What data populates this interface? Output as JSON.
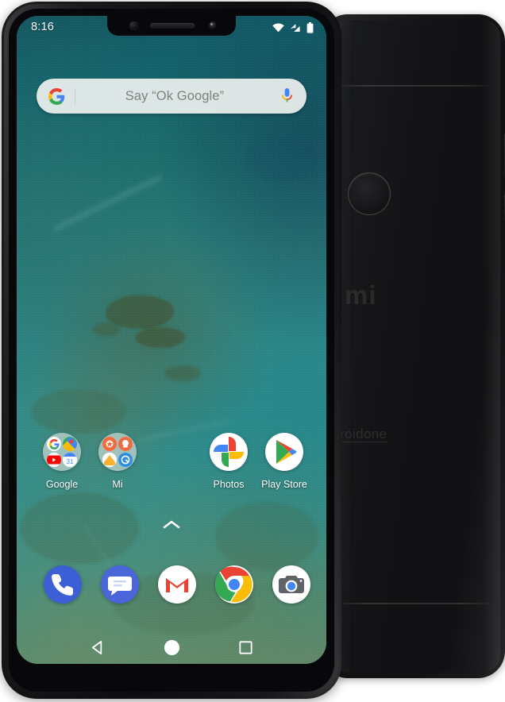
{
  "product": {
    "brand_logo": "mi",
    "program_text_visible": "roidone",
    "program_text_full": "androidone"
  },
  "front": {
    "statusbar": {
      "time": "8:16",
      "icons": [
        "wifi-icon",
        "signal-icon",
        "battery-icon"
      ]
    },
    "search": {
      "placeholder": "Say “Ok Google”",
      "left_icon": "google-g-icon",
      "right_icon": "microphone-icon"
    },
    "apps": [
      {
        "label": "Google",
        "icon": "google-folder-icon",
        "type": "folder"
      },
      {
        "label": "Mi",
        "icon": "mi-folder-icon",
        "type": "folder"
      },
      {
        "label": "Photos",
        "icon": "google-photos-icon",
        "type": "app"
      },
      {
        "label": "Play Store",
        "icon": "google-play-store-icon",
        "type": "app"
      }
    ],
    "drawer_handle": "chevron-up-icon",
    "dock": [
      {
        "name": "Phone",
        "icon": "phone-icon"
      },
      {
        "name": "Messages",
        "icon": "messages-icon"
      },
      {
        "name": "Gmail",
        "icon": "gmail-icon"
      },
      {
        "name": "Chrome",
        "icon": "chrome-icon"
      },
      {
        "name": "Camera",
        "icon": "camera-icon"
      }
    ],
    "navbar": [
      {
        "name": "Back",
        "icon": "back-triangle-icon"
      },
      {
        "name": "Home",
        "icon": "home-circle-icon"
      },
      {
        "name": "Recents",
        "icon": "recents-square-icon"
      }
    ]
  },
  "colors": {
    "body_black": "#131315",
    "screen_teal": "#2c7f7c",
    "screen_deep": "#14565f",
    "reef_olive": "#405232",
    "search_bg": "#ecf0ee",
    "search_text": "#7b8482",
    "google_blue": "#4285F4",
    "google_red": "#EA4335",
    "google_yellow": "#FBBC05",
    "google_green": "#34A853",
    "label_white": "#ffffff"
  }
}
